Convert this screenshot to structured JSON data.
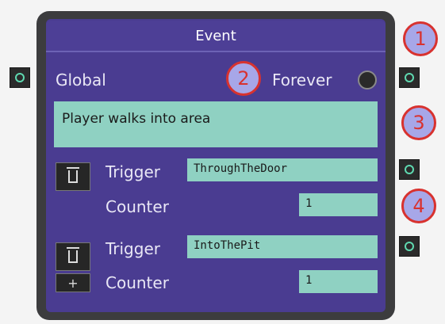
{
  "node": {
    "title": "Event",
    "scope": "Global",
    "mode": "Forever",
    "description": "Player walks into area",
    "triggers": [
      {
        "label": "Trigger",
        "value": "ThroughTheDoor",
        "counter_label": "Counter",
        "counter": "1"
      },
      {
        "label": "Trigger",
        "value": "IntoThePit",
        "counter_label": "Counter",
        "counter": "1"
      }
    ],
    "add_button": "+"
  },
  "badges": [
    "1",
    "2",
    "3",
    "4"
  ],
  "icons": {
    "delete": "trash-icon",
    "port": "port-ring-icon"
  },
  "colors": {
    "node_bg": "#4a3c91",
    "frame": "#3c3c3e",
    "field": "#8fd1c2",
    "port_ring": "#5fd9b0",
    "badge_fill": "#a7a7e8",
    "badge_stroke": "#d8322f"
  }
}
